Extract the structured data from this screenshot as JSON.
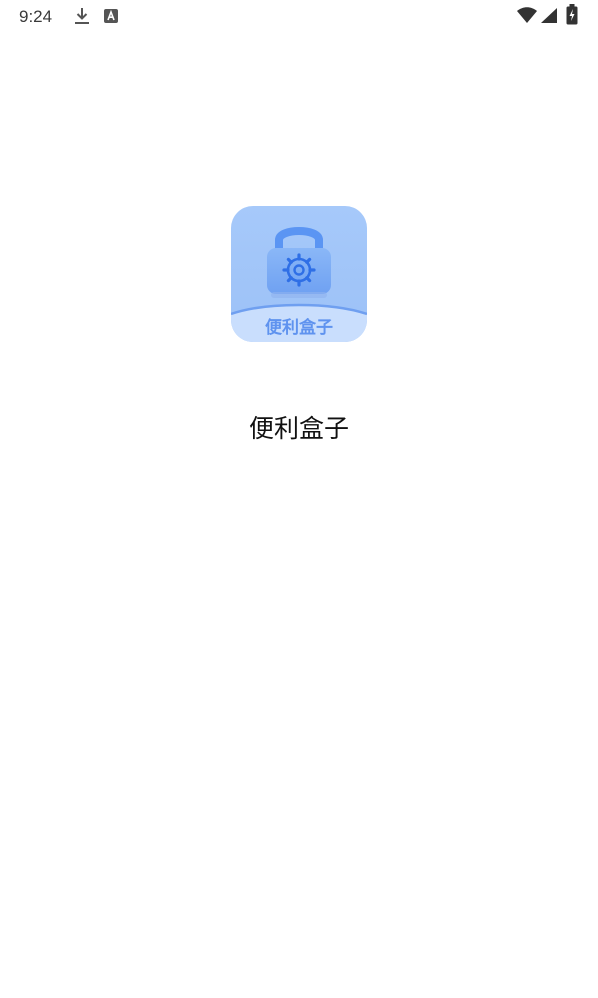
{
  "status_bar": {
    "time": "9:24",
    "left_icons": [
      "download-icon",
      "a-notification-icon"
    ],
    "right_icons": [
      "wifi-icon",
      "cell-signal-icon",
      "battery-charging-icon"
    ]
  },
  "splash": {
    "logo_text": "便利盒子",
    "app_name": "便利盒子",
    "logo_icon": "lock-gear-icon"
  },
  "colors": {
    "background": "#ffffff",
    "logo_light_blue": "#b6d4fb",
    "logo_blue": "#8fb9f6",
    "logo_accent": "#4f8df2"
  }
}
